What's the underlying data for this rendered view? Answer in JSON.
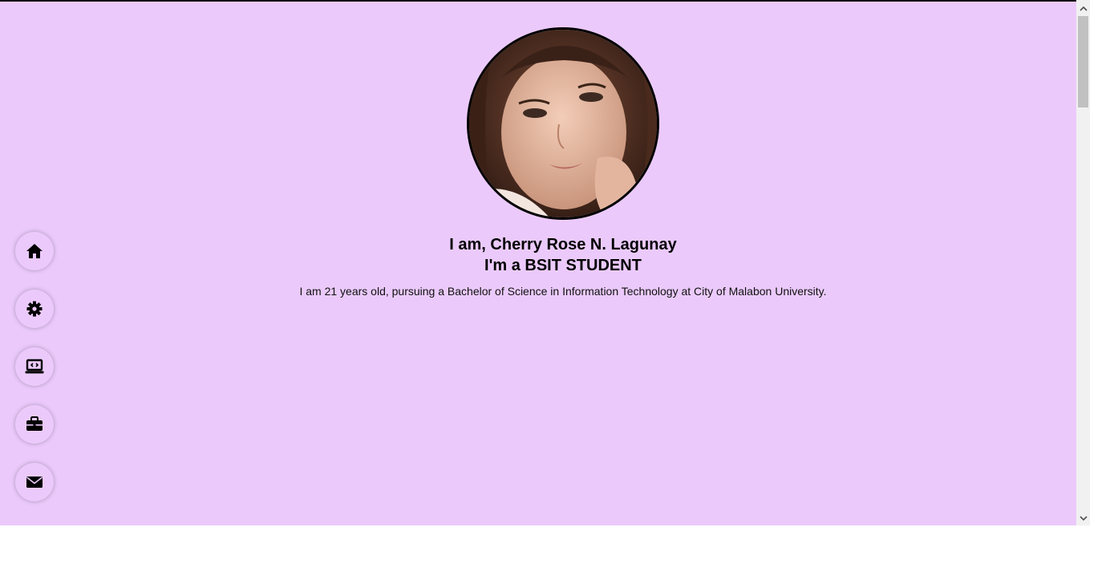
{
  "profile": {
    "heading_name": "I am, Cherry Rose N. Lagunay",
    "heading_role": "I'm a BSIT STUDENT",
    "bio": "I am 21 years old, pursuing a Bachelor of Science in Information Technology at City of Malabon University."
  },
  "sidenav": {
    "items": [
      {
        "icon": "home-icon"
      },
      {
        "icon": "gear-icon"
      },
      {
        "icon": "laptop-code-icon"
      },
      {
        "icon": "briefcase-icon"
      },
      {
        "icon": "envelope-icon"
      }
    ]
  },
  "colors": {
    "background": "#ebcafb",
    "text": "#000000"
  }
}
